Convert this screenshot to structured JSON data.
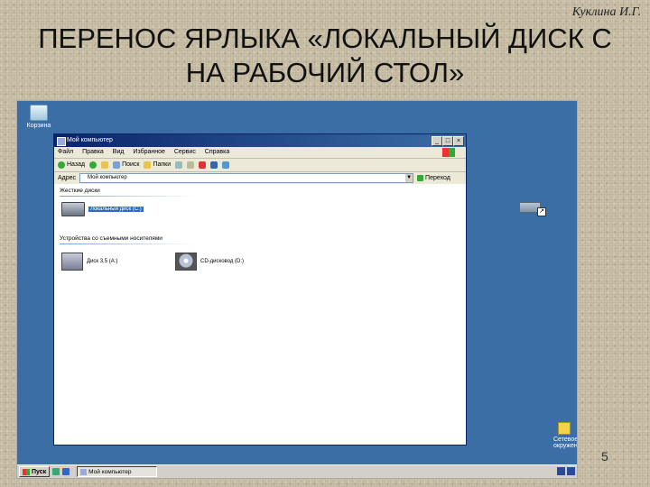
{
  "slide": {
    "author": "Куклина И.Г.",
    "title_line1": "ПЕРЕНОС ЯРЛЫКА «ЛОКАЛЬНЫЙ ДИСК С",
    "title_line2": "НА РАБОЧИЙ СТОЛ»",
    "page_number": "5"
  },
  "desktop": {
    "background_color": "#3a6ea5",
    "icons": {
      "recycle_bin": "Корзина",
      "network": "Сетевое окружение"
    }
  },
  "window": {
    "title": "Мой компьютер",
    "controls": {
      "minimize": "_",
      "maximize": "□",
      "close": "×"
    },
    "menu": [
      "Файл",
      "Правка",
      "Вид",
      "Избранное",
      "Сервис",
      "Справка"
    ],
    "toolbar": {
      "back": "Назад",
      "search": "Поиск",
      "folders": "Папки"
    },
    "address": {
      "label": "Адрес",
      "value": "Мой компьютер",
      "go": "Переход"
    },
    "sections": {
      "hard_disks": "Жесткие диски",
      "removable": "Устройства со съемными носителями"
    },
    "drives": {
      "local_c": "Локальный диск (C:)",
      "floppy": "Диск 3,5 (A:)",
      "cd": "CD-дисковод (D:)"
    }
  },
  "taskbar": {
    "start": "Пуск",
    "task_button": "Мой компьютер"
  }
}
